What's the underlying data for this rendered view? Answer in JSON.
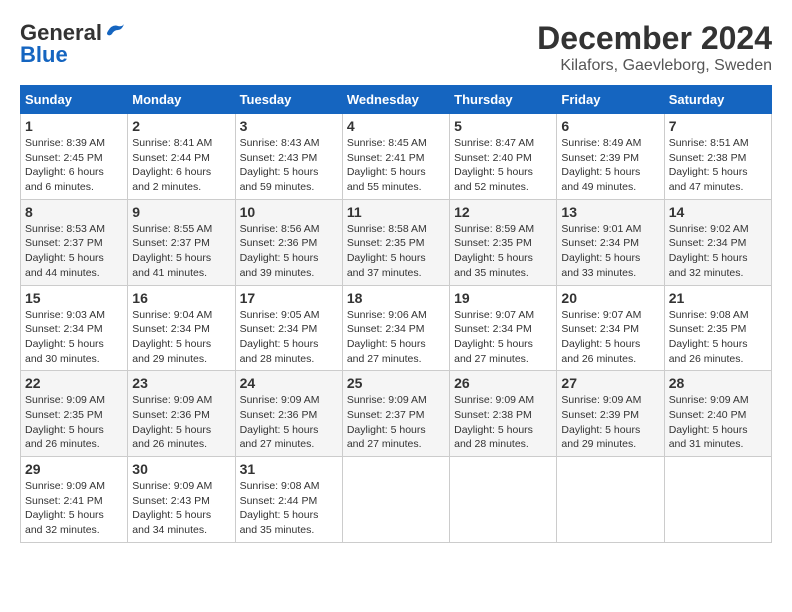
{
  "logo": {
    "general": "General",
    "blue": "Blue"
  },
  "title": "December 2024",
  "subtitle": "Kilafors, Gaevleborg, Sweden",
  "days_of_week": [
    "Sunday",
    "Monday",
    "Tuesday",
    "Wednesday",
    "Thursday",
    "Friday",
    "Saturday"
  ],
  "weeks": [
    [
      {
        "day": "1",
        "info": "Sunrise: 8:39 AM\nSunset: 2:45 PM\nDaylight: 6 hours\nand 6 minutes."
      },
      {
        "day": "2",
        "info": "Sunrise: 8:41 AM\nSunset: 2:44 PM\nDaylight: 6 hours\nand 2 minutes."
      },
      {
        "day": "3",
        "info": "Sunrise: 8:43 AM\nSunset: 2:43 PM\nDaylight: 5 hours\nand 59 minutes."
      },
      {
        "day": "4",
        "info": "Sunrise: 8:45 AM\nSunset: 2:41 PM\nDaylight: 5 hours\nand 55 minutes."
      },
      {
        "day": "5",
        "info": "Sunrise: 8:47 AM\nSunset: 2:40 PM\nDaylight: 5 hours\nand 52 minutes."
      },
      {
        "day": "6",
        "info": "Sunrise: 8:49 AM\nSunset: 2:39 PM\nDaylight: 5 hours\nand 49 minutes."
      },
      {
        "day": "7",
        "info": "Sunrise: 8:51 AM\nSunset: 2:38 PM\nDaylight: 5 hours\nand 47 minutes."
      }
    ],
    [
      {
        "day": "8",
        "info": "Sunrise: 8:53 AM\nSunset: 2:37 PM\nDaylight: 5 hours\nand 44 minutes."
      },
      {
        "day": "9",
        "info": "Sunrise: 8:55 AM\nSunset: 2:37 PM\nDaylight: 5 hours\nand 41 minutes."
      },
      {
        "day": "10",
        "info": "Sunrise: 8:56 AM\nSunset: 2:36 PM\nDaylight: 5 hours\nand 39 minutes."
      },
      {
        "day": "11",
        "info": "Sunrise: 8:58 AM\nSunset: 2:35 PM\nDaylight: 5 hours\nand 37 minutes."
      },
      {
        "day": "12",
        "info": "Sunrise: 8:59 AM\nSunset: 2:35 PM\nDaylight: 5 hours\nand 35 minutes."
      },
      {
        "day": "13",
        "info": "Sunrise: 9:01 AM\nSunset: 2:34 PM\nDaylight: 5 hours\nand 33 minutes."
      },
      {
        "day": "14",
        "info": "Sunrise: 9:02 AM\nSunset: 2:34 PM\nDaylight: 5 hours\nand 32 minutes."
      }
    ],
    [
      {
        "day": "15",
        "info": "Sunrise: 9:03 AM\nSunset: 2:34 PM\nDaylight: 5 hours\nand 30 minutes."
      },
      {
        "day": "16",
        "info": "Sunrise: 9:04 AM\nSunset: 2:34 PM\nDaylight: 5 hours\nand 29 minutes."
      },
      {
        "day": "17",
        "info": "Sunrise: 9:05 AM\nSunset: 2:34 PM\nDaylight: 5 hours\nand 28 minutes."
      },
      {
        "day": "18",
        "info": "Sunrise: 9:06 AM\nSunset: 2:34 PM\nDaylight: 5 hours\nand 27 minutes."
      },
      {
        "day": "19",
        "info": "Sunrise: 9:07 AM\nSunset: 2:34 PM\nDaylight: 5 hours\nand 27 minutes."
      },
      {
        "day": "20",
        "info": "Sunrise: 9:07 AM\nSunset: 2:34 PM\nDaylight: 5 hours\nand 26 minutes."
      },
      {
        "day": "21",
        "info": "Sunrise: 9:08 AM\nSunset: 2:35 PM\nDaylight: 5 hours\nand 26 minutes."
      }
    ],
    [
      {
        "day": "22",
        "info": "Sunrise: 9:09 AM\nSunset: 2:35 PM\nDaylight: 5 hours\nand 26 minutes."
      },
      {
        "day": "23",
        "info": "Sunrise: 9:09 AM\nSunset: 2:36 PM\nDaylight: 5 hours\nand 26 minutes."
      },
      {
        "day": "24",
        "info": "Sunrise: 9:09 AM\nSunset: 2:36 PM\nDaylight: 5 hours\nand 27 minutes."
      },
      {
        "day": "25",
        "info": "Sunrise: 9:09 AM\nSunset: 2:37 PM\nDaylight: 5 hours\nand 27 minutes."
      },
      {
        "day": "26",
        "info": "Sunrise: 9:09 AM\nSunset: 2:38 PM\nDaylight: 5 hours\nand 28 minutes."
      },
      {
        "day": "27",
        "info": "Sunrise: 9:09 AM\nSunset: 2:39 PM\nDaylight: 5 hours\nand 29 minutes."
      },
      {
        "day": "28",
        "info": "Sunrise: 9:09 AM\nSunset: 2:40 PM\nDaylight: 5 hours\nand 31 minutes."
      }
    ],
    [
      {
        "day": "29",
        "info": "Sunrise: 9:09 AM\nSunset: 2:41 PM\nDaylight: 5 hours\nand 32 minutes."
      },
      {
        "day": "30",
        "info": "Sunrise: 9:09 AM\nSunset: 2:43 PM\nDaylight: 5 hours\nand 34 minutes."
      },
      {
        "day": "31",
        "info": "Sunrise: 9:08 AM\nSunset: 2:44 PM\nDaylight: 5 hours\nand 35 minutes."
      },
      null,
      null,
      null,
      null
    ]
  ]
}
